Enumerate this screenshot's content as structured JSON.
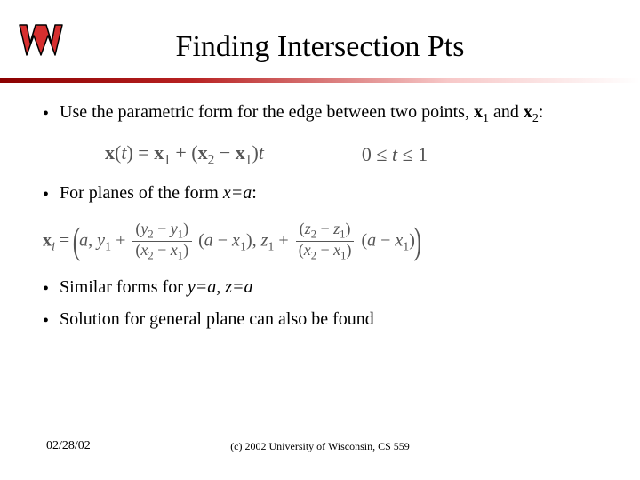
{
  "logo": {
    "letter": "W",
    "alt": "Wisconsin W logo"
  },
  "title": "Finding Intersection Pts",
  "bullets": {
    "b1_pre": "Use the parametric form for the edge between two points, ",
    "b1_x1": "x",
    "b1_sub1": "1",
    "b1_and": " and ",
    "b1_x2": "x",
    "b1_sub2": "2",
    "b1_post": ":",
    "b2_pre": "For planes of the form ",
    "b2_eq": "x=a",
    "b2_post": ":",
    "b3_pre": "Similar forms for ",
    "b3_eq": "y=a, z=a",
    "b4": "Solution for general plane can also be found"
  },
  "equations": {
    "eq1_left": "x(t) = x₁ + (x₂ − x₁)t",
    "eq1_right": "0 ≤ t ≤ 1",
    "eq2": {
      "lead": "xᵢ = (a, y₁ + ",
      "f1_num": "(y₂ − y₁)",
      "f1_den": "(x₂ − x₁)",
      "mid1": "(a − x₁), z₁ + ",
      "f2_num": "(z₂ − z₁)",
      "f2_den": "(x₂ − x₁)",
      "tail": "(a − x₁))"
    }
  },
  "footer": {
    "date": "02/28/02",
    "copyright": "(c) 2002 University of Wisconsin, CS 559"
  }
}
